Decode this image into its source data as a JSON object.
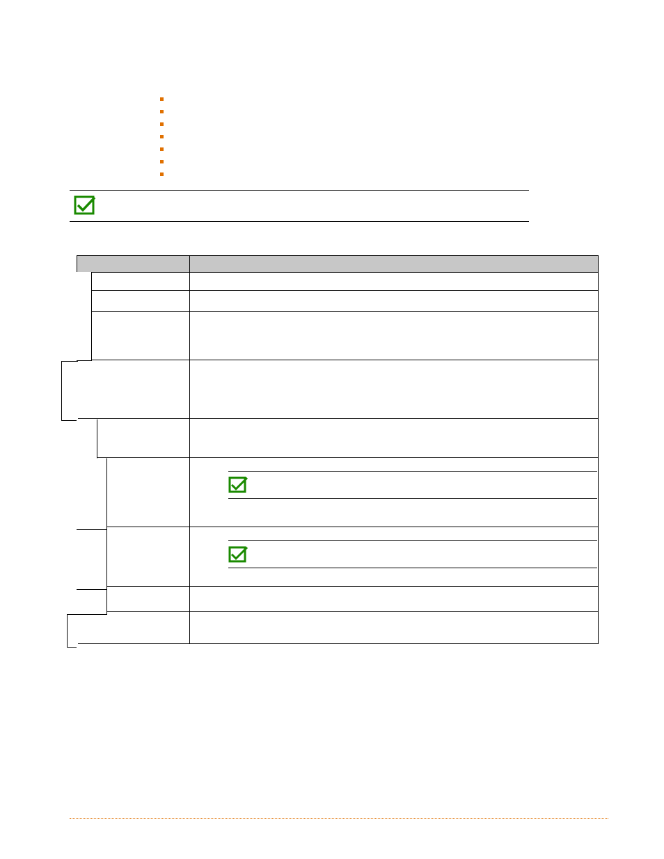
{
  "bullets": [
    "",
    "",
    "",
    "",
    "",
    "",
    ""
  ],
  "heading": {
    "checked": true,
    "text": ""
  },
  "table": {
    "header": [
      "",
      ""
    ],
    "rows": [
      {
        "a": "",
        "b": "",
        "offset": true
      },
      {
        "a": "",
        "b": "",
        "offset": true
      },
      {
        "a": "",
        "b": "",
        "offset": true
      },
      {
        "a": "",
        "b": "",
        "offset": false
      },
      {
        "a": "",
        "b": "",
        "offset": true
      },
      {
        "a": "",
        "b_inner": {
          "checked": true,
          "text": ""
        },
        "offset": true
      },
      {
        "a": "",
        "b_inner": {
          "checked": true,
          "text": ""
        },
        "offset": true
      },
      {
        "a": "",
        "b": "",
        "offset": true
      },
      {
        "a": "",
        "b": "",
        "offset": false
      }
    ]
  }
}
